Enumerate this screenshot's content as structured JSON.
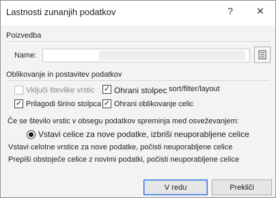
{
  "window": {
    "title": "Lastnosti zunanjih podatkov",
    "help_glyph": "?",
    "close_glyph": "✕"
  },
  "query": {
    "section_label": "Poizvedba",
    "name_label": "Name:",
    "name_value": ""
  },
  "format": {
    "section_label": "Oblikovanje in postavitev podatkov",
    "options": {
      "row_numbers": {
        "label": "Vključi številke vrstic",
        "checked": false,
        "enabled": false
      },
      "preserve_sort": {
        "label": "Ohrani stolpec",
        "checked": true,
        "enabled": true
      },
      "preserve_sort_suffix": "sort/filter/layout",
      "adjust_width": {
        "label": "Prilagodi širino stolpca",
        "checked": true,
        "enabled": true
      },
      "preserve_format": {
        "label": "Ohrani oblikovanje celic",
        "checked": true,
        "enabled": true
      }
    }
  },
  "refresh": {
    "prompt": "Če se število vrstic v obsegu podatkov spreminja med osveževanjem:",
    "options": [
      {
        "label": "Vstavi celice za nove podatke, izbriši neuporabljene celice",
        "selected": true
      },
      {
        "label": "Vstavi celotne vrstice za nove podatke, počisti neuporabljene celice",
        "selected": false
      },
      {
        "label": "Prepiši obstoječe celice z novimi podatki, počisti neuporabljene celice",
        "selected": false
      }
    ]
  },
  "buttons": {
    "ok": "V redu",
    "cancel": "Prekliči"
  },
  "check_glyph": "✓"
}
